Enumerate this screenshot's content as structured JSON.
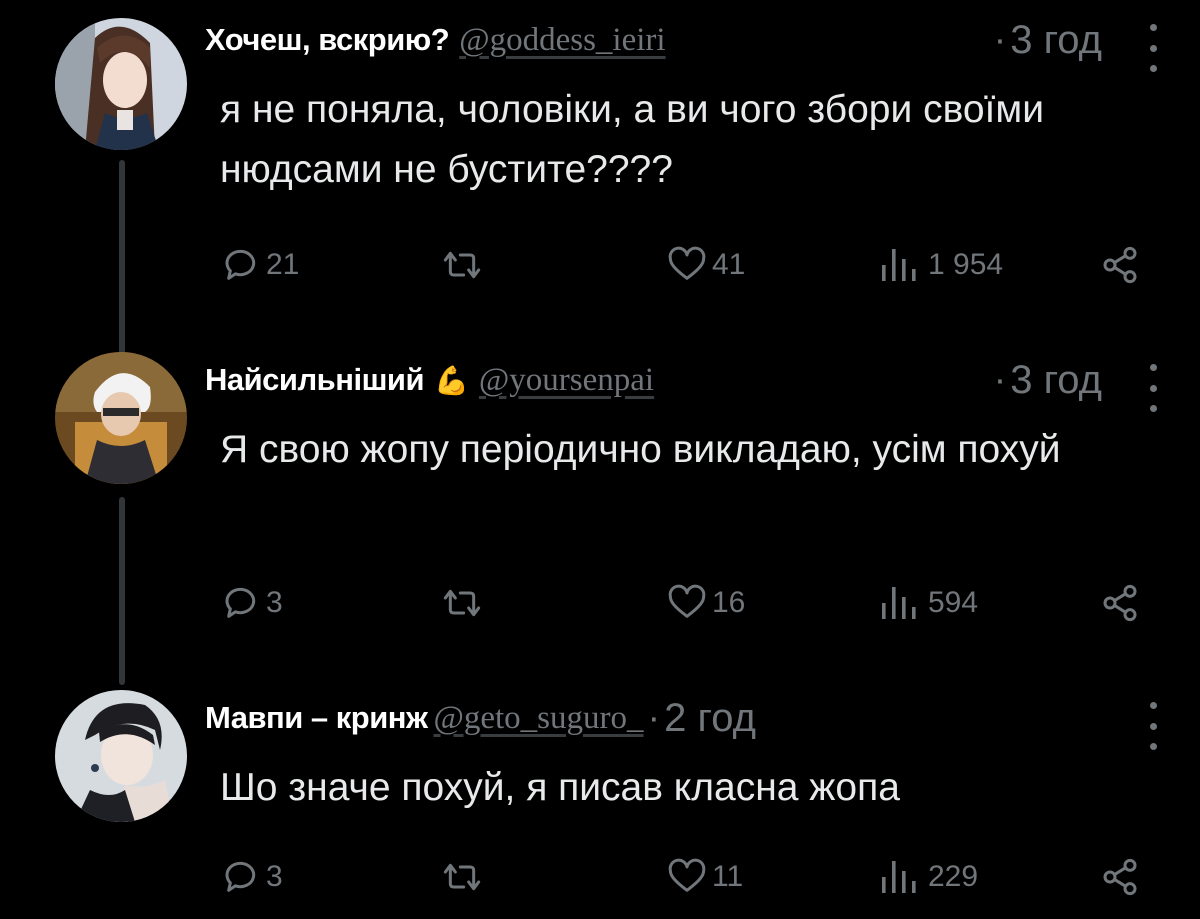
{
  "tweets": [
    {
      "name": "Хочеш, вскрию?",
      "emoji": "",
      "handle": "@goddess_ieiri",
      "time": "3 год",
      "text": "я не поняла, чоловіки, а ви чого збори своїми нюдсами не бустите????",
      "replies": "21",
      "retweets": "",
      "likes": "41",
      "views": "1 954"
    },
    {
      "name": "Найсильніший",
      "emoji": "💪",
      "handle": "@yoursenpai",
      "time": "3 год",
      "text": "Я свою жопу періодично викладаю, усім похуй",
      "replies": "3",
      "retweets": "",
      "likes": "16",
      "views": "594"
    },
    {
      "name": "Мавпи – кринж",
      "emoji": "",
      "handle": "@geto_suguro_",
      "time": "2 год",
      "text": "Шо значе похуй, я писав класна жопа",
      "replies": "3",
      "retweets": "",
      "likes": "11",
      "views": "229"
    }
  ],
  "icons": {
    "reply": "reply-icon",
    "retweet": "retweet-icon",
    "like": "heart-icon",
    "views": "views-icon",
    "share": "share-icon",
    "more": "more-icon"
  },
  "colors": {
    "background": "#000000",
    "muted": "#71767b",
    "text": "#e7e9ea",
    "thread_line": "#333639"
  }
}
